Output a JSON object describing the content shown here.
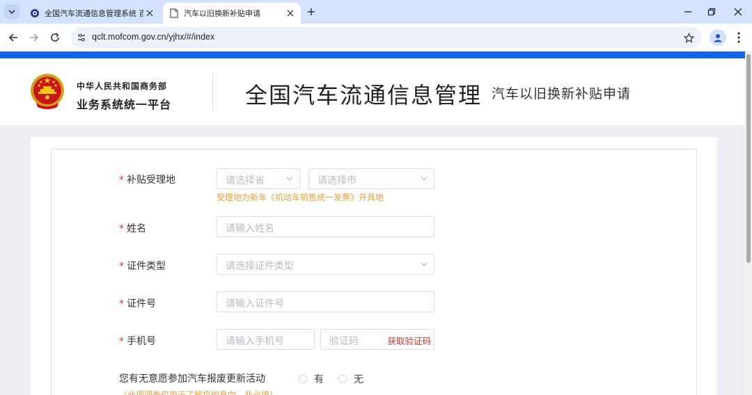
{
  "browser": {
    "tabs": [
      {
        "title": "全国汽车流通信息管理系统 百度",
        "icon": "gov-emblem-favicon-icon",
        "active": false
      },
      {
        "title": "汽车以旧换新补贴申请",
        "icon": "document-favicon-icon",
        "active": true
      }
    ],
    "url": "qclt.mofcom.gov.cn/yjhx/#/index"
  },
  "header": {
    "org_line1": "中华人民共和国商务部",
    "org_line2": "业务系统统一平台",
    "main_title": "全国汽车流通信息管理",
    "sub_title": "汽车以旧换新补贴申请"
  },
  "form": {
    "required_mark": "*",
    "location": {
      "label": "补贴受理地",
      "province_placeholder": "请选择省",
      "city_placeholder": "请选择市",
      "hint": "受理地为新车《机动车销售统一发票》开具地"
    },
    "name": {
      "label": "姓名",
      "placeholder": "请输入姓名"
    },
    "id_type": {
      "label": "证件类型",
      "placeholder": "请选择证件类型"
    },
    "id_number": {
      "label": "证件号",
      "placeholder": "请输入证件号"
    },
    "phone": {
      "label": "手机号",
      "placeholder": "请输入手机号",
      "code_placeholder": "验证码",
      "get_code": "获取验证码"
    },
    "scrap_question": {
      "label": "您有无意愿参加汽车报废更新活动",
      "option_yes": "有",
      "option_no": "无",
      "note": "（此项调查仅用于了解您的意向，非必填）"
    }
  },
  "colors": {
    "brand_blue": "#1565e6",
    "required_red": "#e6322b",
    "hint_orange": "#e6a23c",
    "get_code_red": "#c0392b"
  }
}
